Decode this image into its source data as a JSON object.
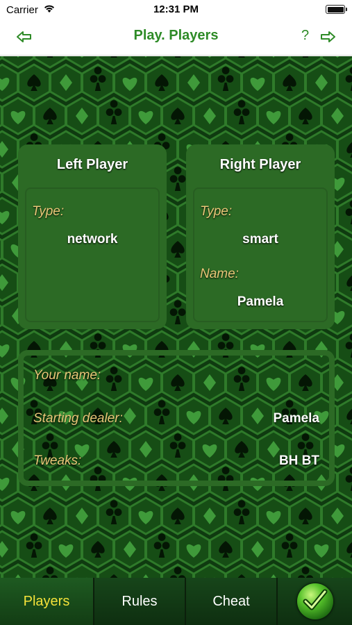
{
  "status_bar": {
    "carrier": "Carrier",
    "time": "12:31 PM"
  },
  "nav": {
    "title": "Play. Players",
    "help": "?"
  },
  "left_player": {
    "title": "Left Player",
    "type_label": "Type:",
    "type_value": "network"
  },
  "right_player": {
    "title": "Right Player",
    "type_label": "Type:",
    "type_value": "smart",
    "name_label": "Name:",
    "name_value": "Pamela"
  },
  "settings": {
    "your_name_label": "Your name:",
    "your_name_value": "",
    "dealer_label": "Starting dealer:",
    "dealer_value": "Pamela",
    "tweaks_label": "Tweaks:",
    "tweaks_value": "BH BT"
  },
  "tabs": [
    {
      "label": "Players",
      "active": true
    },
    {
      "label": "Rules",
      "active": false
    },
    {
      "label": "Cheat",
      "active": false
    }
  ],
  "colors": {
    "accent": "#2e8b27",
    "label": "#e9c878",
    "active_tab": "#f4e23a"
  }
}
